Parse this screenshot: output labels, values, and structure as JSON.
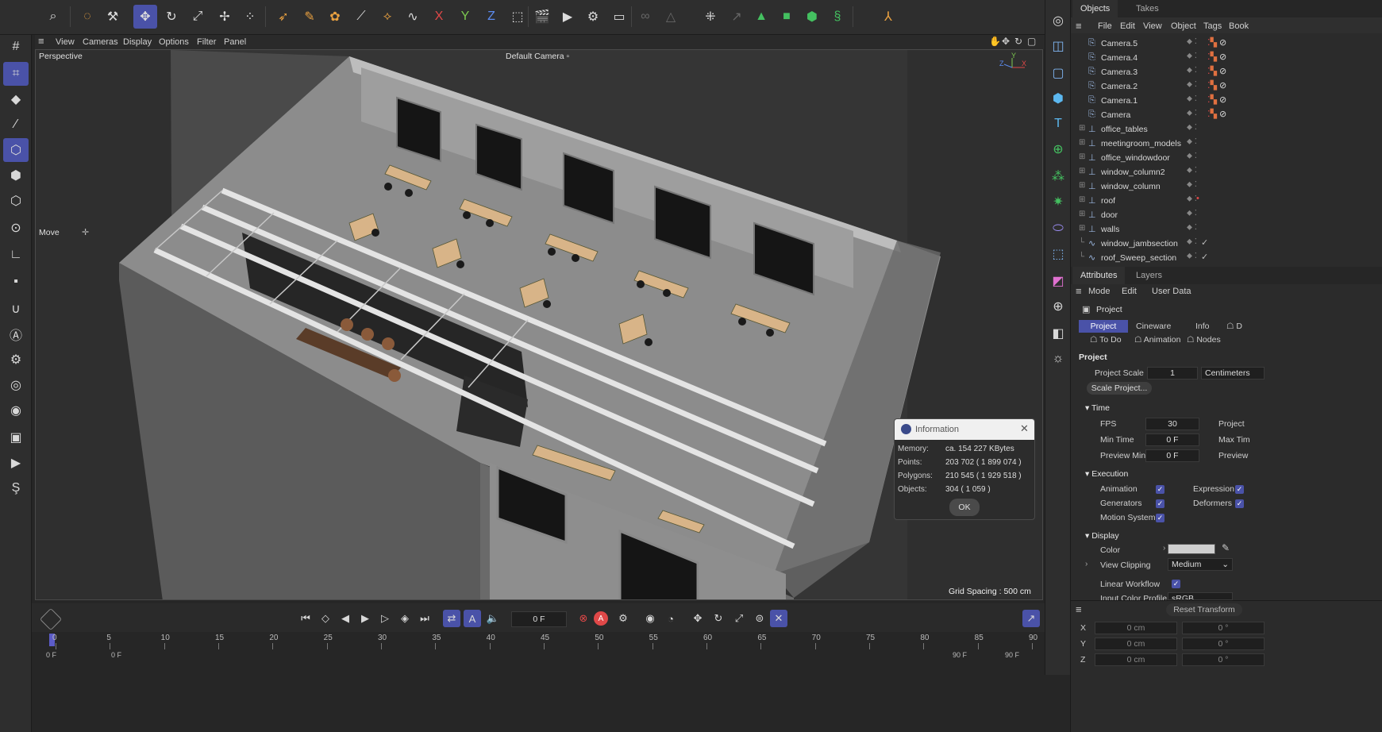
{
  "colors": {
    "accent": "#4a52a8",
    "panel": "#2b2b2b",
    "viewport_bg": "#2f2f2f",
    "alert_red": "#e04848"
  },
  "top_toolbar": {
    "icons": [
      "search-icon",
      "live-selection-icon",
      "model-tool-icon",
      "move-icon",
      "rotate-icon",
      "scale-icon",
      "snap-move-icon",
      "nodes-icon",
      "sculpt-icon",
      "paint-icon",
      "spline-pen-icon",
      "brush-icon",
      "spline-icon",
      "x-axis-icon",
      "y-axis-icon",
      "z-axis-icon",
      "coordinate-system-icon",
      "render-view-icon",
      "render-picture-viewer-icon",
      "render-settings-icon",
      "view-menu-icon",
      "link-icon",
      "warning-icon",
      "snap-icon",
      "particles-icon",
      "move-point-icon",
      "deformer-icon",
      "cube-green-icon",
      "cube-white-icon",
      "spline-green-icon",
      "bone-icon"
    ],
    "axis_labels": {
      "x": "X",
      "y": "Y",
      "z": "Z"
    }
  },
  "viewport": {
    "menu": [
      "View",
      "Cameras",
      "Display",
      "Options",
      "Filter",
      "Panel"
    ],
    "label": "Perspective",
    "camera_label": "Default Camera",
    "tool_label": "Move",
    "grid_spacing": "Grid Spacing : 500 cm",
    "axis": {
      "x": "X",
      "y": "Y",
      "z": "Z"
    }
  },
  "info_dialog": {
    "title": "Information",
    "rows": [
      {
        "label": "Memory:",
        "value": "ca. 154 227 KBytes"
      },
      {
        "label": "Points:",
        "value": "203 702 ( 1 899 074 )"
      },
      {
        "label": "Polygons:",
        "value": "210 545 ( 1 929 518 )"
      },
      {
        "label": "Objects:",
        "value": "304 ( 1 059 )"
      }
    ],
    "ok_label": "OK"
  },
  "objects_panel": {
    "tabs": [
      "Objects",
      "Takes"
    ],
    "menu": [
      "File",
      "Edit",
      "View",
      "Object",
      "Tags",
      "Book"
    ],
    "items": [
      {
        "name": "Camera.5",
        "type": "camera"
      },
      {
        "name": "Camera.4",
        "type": "camera"
      },
      {
        "name": "Camera.3",
        "type": "camera"
      },
      {
        "name": "Camera.2",
        "type": "camera"
      },
      {
        "name": "Camera.1",
        "type": "camera"
      },
      {
        "name": "Camera",
        "type": "camera"
      },
      {
        "name": "office_tables",
        "type": "group"
      },
      {
        "name": "meetingroom_models",
        "type": "group"
      },
      {
        "name": "office_windowdoor",
        "type": "group"
      },
      {
        "name": "window_column2",
        "type": "group"
      },
      {
        "name": "window_column",
        "type": "group"
      },
      {
        "name": "roof",
        "type": "group"
      },
      {
        "name": "door",
        "type": "group"
      },
      {
        "name": "walls",
        "type": "group"
      },
      {
        "name": "window_jambsection",
        "type": "spline"
      },
      {
        "name": "roof_Sweep_section",
        "type": "spline"
      }
    ]
  },
  "attributes_panel": {
    "tabs": [
      "Attributes",
      "Layers"
    ],
    "menu": [
      "Mode",
      "Edit",
      "User Data"
    ],
    "object_label": "Project",
    "subtabs": [
      "Project",
      "Cineware",
      "Info",
      "D"
    ],
    "subtabs2": [
      "To Do",
      "Animation",
      "Nodes"
    ],
    "section_title": "Project",
    "project_scale_label": "Project Scale",
    "project_scale_value": "1",
    "project_scale_unit": "Centimeters",
    "scale_project_button": "Scale Project...",
    "time_section": "Time",
    "fps_label": "FPS",
    "fps_value": "30",
    "project_label": "Project",
    "min_time_label": "Min Time",
    "min_time_value": "0 F",
    "max_time_label": "Max Tim",
    "preview_min_label": "Preview Min",
    "preview_min_value": "0 F",
    "preview_label": "Preview",
    "execution_section": "Execution",
    "animation_label": "Animation",
    "expression_label": "Expression",
    "generators_label": "Generators",
    "deformers_label": "Deformers",
    "motion_system_label": "Motion System",
    "display_section": "Display",
    "color_label": "Color",
    "view_clipping_label": "View Clipping",
    "view_clipping_value": "Medium",
    "linear_workflow_label": "Linear Workflow",
    "input_color_profile_label": "Input Color Profile",
    "input_color_profile_value": "sRGB"
  },
  "coordinates_panel": {
    "reset_label": "Reset Transform",
    "rows": [
      {
        "axis": "X",
        "pos": "0 cm",
        "rot": "0 °"
      },
      {
        "axis": "Y",
        "pos": "0 cm",
        "rot": "0 °"
      },
      {
        "axis": "Z",
        "pos": "0 cm",
        "rot": "0 °"
      }
    ]
  },
  "timeline": {
    "current_frame": "0 F",
    "start_frame": "0 F",
    "start_frame2": "0 F",
    "end_frame": "90 F",
    "end_frame2": "90 F",
    "ruler_ticks": [
      0,
      5,
      10,
      15,
      20,
      25,
      30,
      35,
      40,
      45,
      50,
      55,
      60,
      65,
      70,
      75,
      80,
      85,
      90
    ]
  }
}
